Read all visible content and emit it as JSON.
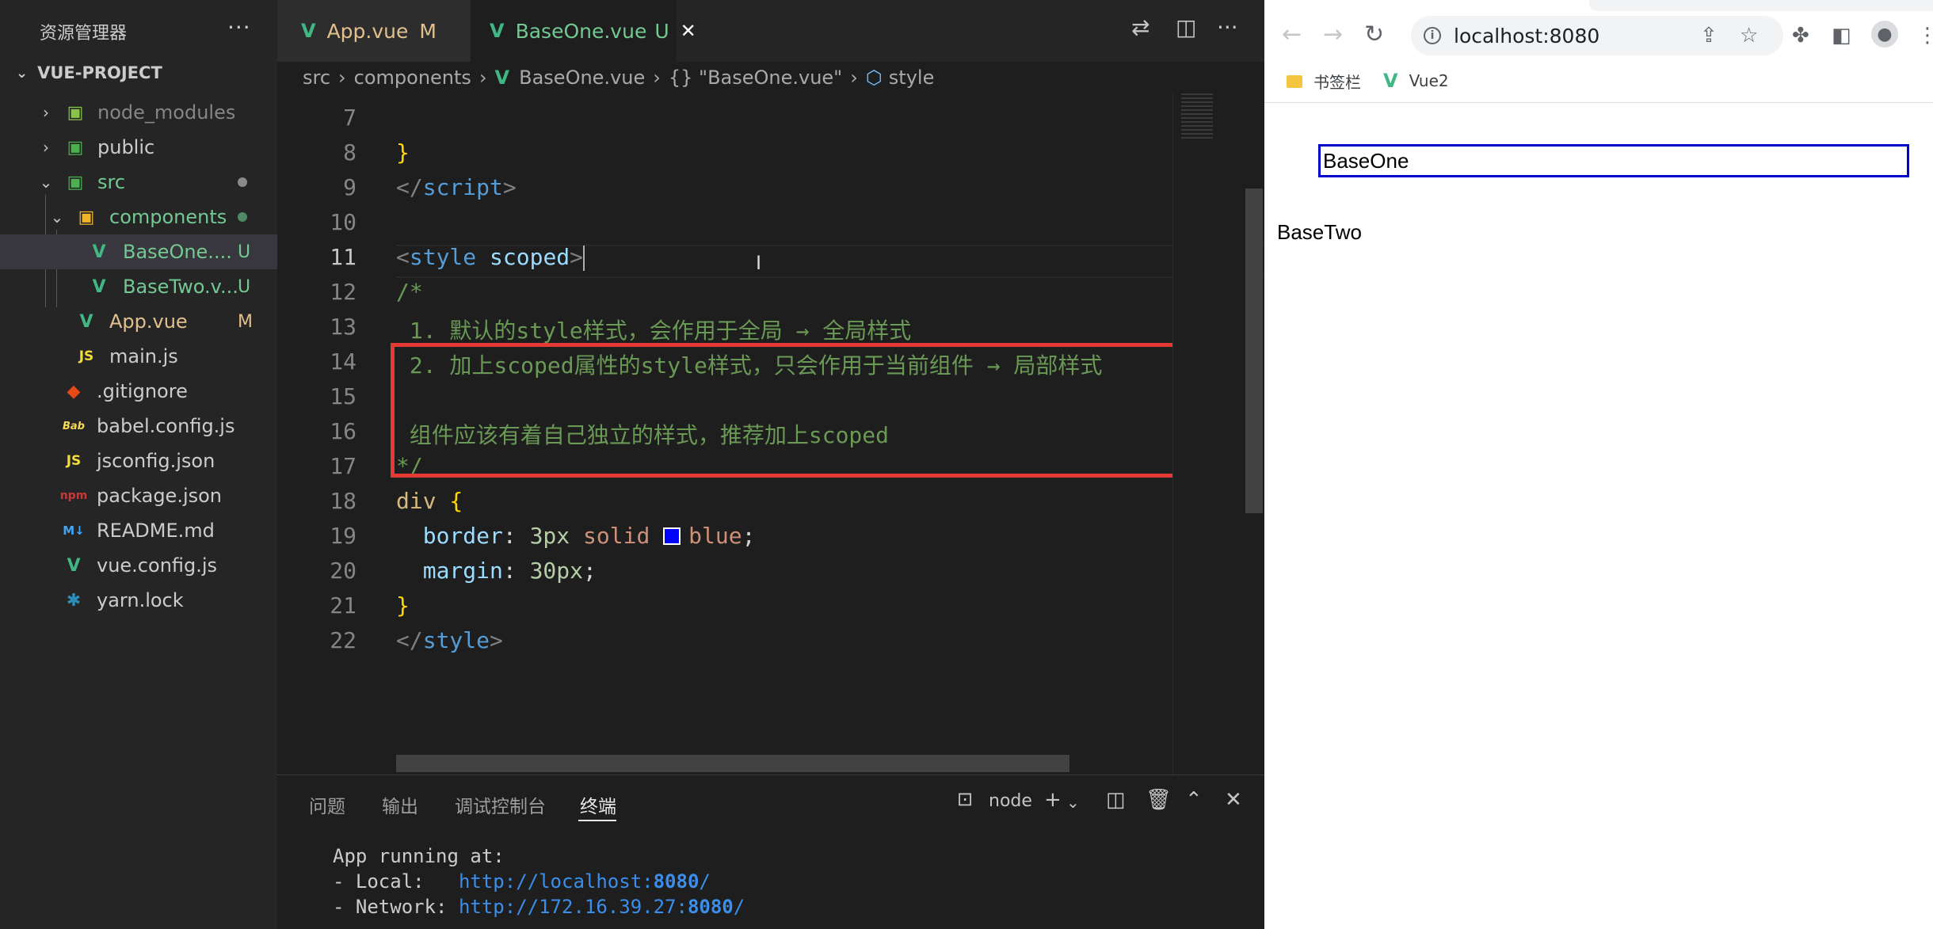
{
  "explorer": {
    "title": "资源管理器",
    "more": "···",
    "project": "VUE-PROJECT",
    "items": [
      {
        "name": "node_modules",
        "icon": "folder-node-icon",
        "color": "#858585",
        "status": ""
      },
      {
        "name": "public",
        "icon": "folder-public-icon",
        "color": "#cccccc",
        "status": ""
      },
      {
        "name": "src",
        "icon": "folder-src-icon",
        "color": "#73c991",
        "status": "dot"
      },
      {
        "name": "components",
        "icon": "folder-components-icon",
        "color": "#73c991",
        "status": "dot"
      },
      {
        "name": "BaseOne....",
        "icon": "vue-icon",
        "color": "#73c991",
        "status": "U"
      },
      {
        "name": "BaseTwo.v...",
        "icon": "vue-icon",
        "color": "#73c991",
        "status": "U"
      },
      {
        "name": "App.vue",
        "icon": "vue-icon",
        "color": "#e2c08d",
        "status": "M"
      },
      {
        "name": "main.js",
        "icon": "js-icon",
        "color": "#cccccc",
        "status": ""
      },
      {
        "name": ".gitignore",
        "icon": "git-icon",
        "color": "#cccccc",
        "status": ""
      },
      {
        "name": "babel.config.js",
        "icon": "babel-icon",
        "color": "#cccccc",
        "status": ""
      },
      {
        "name": "jsconfig.json",
        "icon": "js-icon",
        "color": "#cccccc",
        "status": ""
      },
      {
        "name": "package.json",
        "icon": "npm-icon",
        "color": "#cccccc",
        "status": ""
      },
      {
        "name": "README.md",
        "icon": "markdown-icon",
        "color": "#cccccc",
        "status": ""
      },
      {
        "name": "vue.config.js",
        "icon": "vue-config-icon",
        "color": "#cccccc",
        "status": ""
      },
      {
        "name": "yarn.lock",
        "icon": "yarn-icon",
        "color": "#cccccc",
        "status": ""
      }
    ],
    "status_U": "U",
    "status_M": "M"
  },
  "tabs": [
    {
      "label": "App.vue",
      "status": "M",
      "active": false
    },
    {
      "label": "BaseOne.vue",
      "status": "U",
      "active": true,
      "close": "✕"
    }
  ],
  "breadcrumb": {
    "parts": [
      "src",
      "components",
      "BaseOne.vue",
      "{} \"BaseOne.vue\"",
      "style"
    ]
  },
  "editor": {
    "current_line": 11,
    "lines": [
      {
        "n": "7"
      },
      {
        "n": "8"
      },
      {
        "n": "9"
      },
      {
        "n": "10"
      },
      {
        "n": "11"
      },
      {
        "n": "12"
      },
      {
        "n": "13"
      },
      {
        "n": "14"
      },
      {
        "n": "15"
      },
      {
        "n": "16"
      },
      {
        "n": "17"
      },
      {
        "n": "18"
      },
      {
        "n": "19"
      },
      {
        "n": "20"
      },
      {
        "n": "21"
      },
      {
        "n": "22"
      }
    ],
    "code": {
      "l8": "}",
      "l9_a": "</",
      "l9_b": "script",
      "l9_c": ">",
      "l11_a": "<",
      "l11_b": "style",
      "l11_c": " scoped",
      "l11_d": ">",
      "l12": "/*",
      "l13": " 1. 默认的style样式，会作用于全局 → 全局样式",
      "l14": " 2. 加上scoped属性的style样式，只会作用于当前组件 → 局部样式",
      "l16": " 组件应该有着自己独立的样式，推荐加上scoped",
      "l17": "*/",
      "l18_sel": "div",
      "l18_br": " {",
      "l19_prop": "  border",
      "l19_colon": ": ",
      "l19_num": "3px",
      "l19_solid": " solid ",
      "l19_blue": "blue",
      "l19_end": ";",
      "l20_prop": "  margin",
      "l20_colon": ": ",
      "l20_num": "30px",
      "l20_end": ";",
      "l21": "}",
      "l22_a": "</",
      "l22_b": "style",
      "l22_c": ">"
    }
  },
  "panel": {
    "tabs": [
      "问题",
      "输出",
      "调试控制台",
      "终端"
    ],
    "active_tab": "终端",
    "terminal_name": "node",
    "terminal": {
      "line1": "App running at:",
      "local_label": "- Local:   ",
      "local_url_a": "http://localhost:",
      "local_url_b": "8080",
      "local_url_c": "/",
      "net_label": "- Network: ",
      "net_url_a": "http://172.16.39.27:",
      "net_url_b": "8080",
      "net_url_c": "/"
    }
  },
  "browser": {
    "url": "localhost:8080",
    "bookmarks": [
      {
        "label": "书签栏",
        "icon": "folder-icon"
      },
      {
        "label": "Vue2",
        "icon": "vue-icon"
      }
    ],
    "page": {
      "base_one": "BaseOne",
      "base_two": "BaseTwo"
    }
  },
  "colors": {
    "vue_green": "#41b883",
    "highlight_box": "#e53935",
    "rendered_border": "#0000cd"
  }
}
